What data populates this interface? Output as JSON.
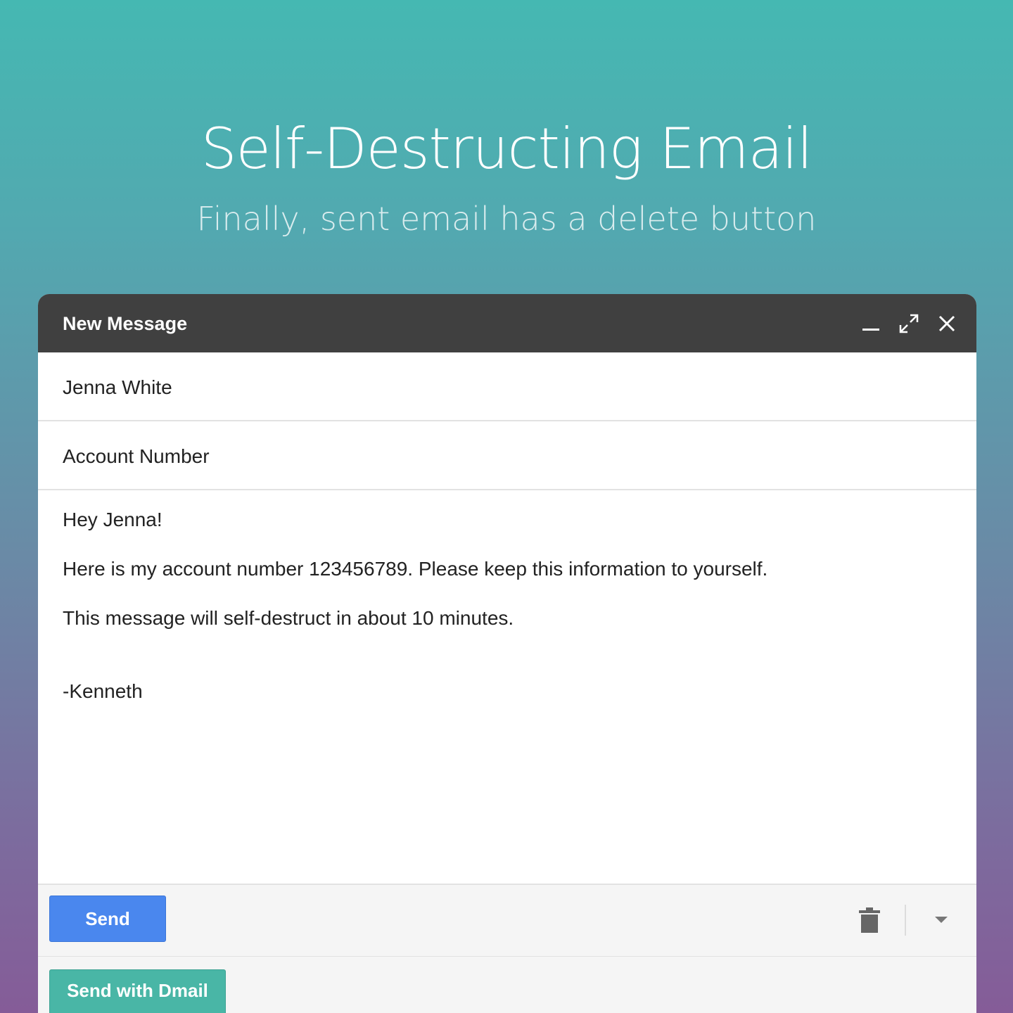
{
  "hero": {
    "title": "Self-Destructing Email",
    "subtitle": "Finally, sent email has a delete button"
  },
  "compose": {
    "window_title": "New Message",
    "to_value": "Jenna White",
    "subject_value": "Account Number",
    "body_lines": [
      "Hey Jenna!",
      "Here is my account number 123456789. Please keep this information to yourself.",
      "This message will self-destruct in about 10 minutes.",
      "-Kenneth"
    ],
    "send_label": "Send",
    "send_dmail_label": "Send with Dmail"
  },
  "icons": {
    "minimize": "minimize-icon",
    "expand": "expand-icon",
    "close": "close-icon",
    "trash": "trash-icon",
    "more": "dropdown-arrow-icon"
  },
  "colors": {
    "header_bar": "#404040",
    "send_button": "#4a87ee",
    "dmail_button": "#49b6a6",
    "background_top": "#45b8b2",
    "background_bottom": "#855c98"
  }
}
